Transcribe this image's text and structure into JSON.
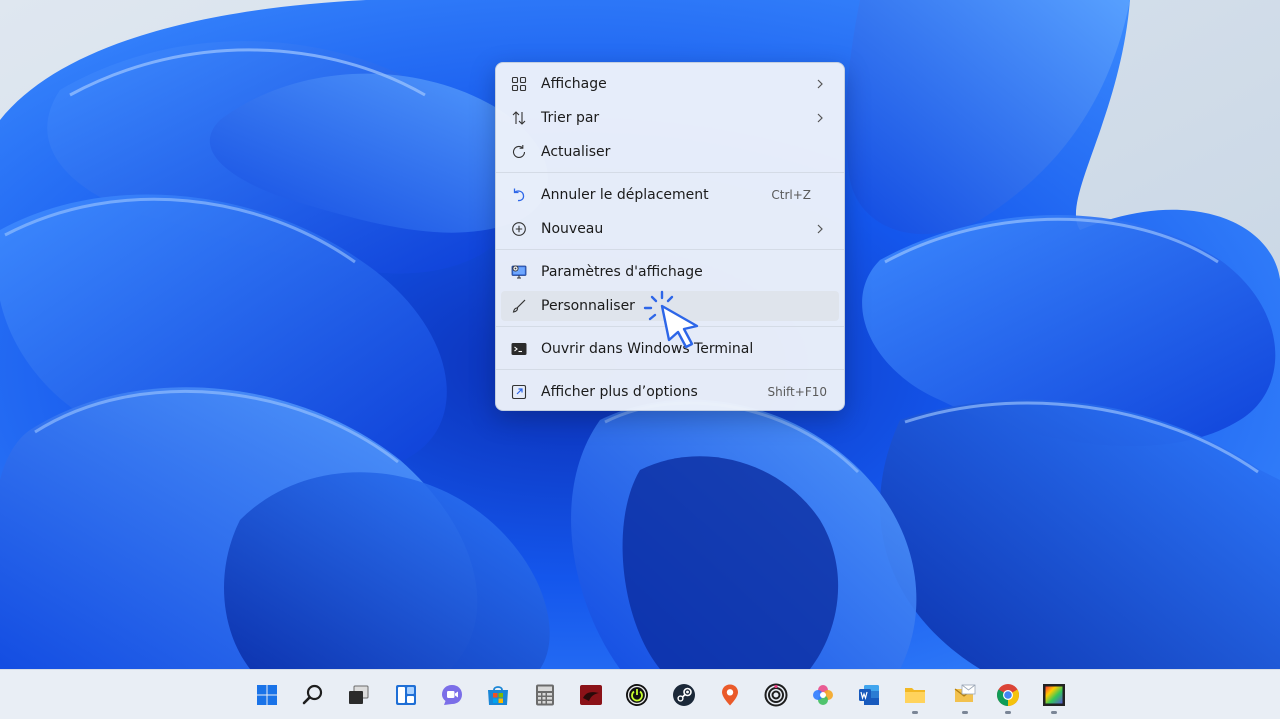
{
  "menu": {
    "items": [
      {
        "label": "Affichage",
        "icon": "view-grid-icon",
        "submenu": true
      },
      {
        "label": "Trier par",
        "icon": "sort-arrows-icon",
        "submenu": true
      },
      {
        "label": "Actualiser",
        "icon": "refresh-icon"
      },
      {
        "label": "Annuler le déplacement",
        "icon": "undo-icon",
        "shortcut": "Ctrl+Z"
      },
      {
        "label": "Nouveau",
        "icon": "new-plus-icon",
        "submenu": true
      },
      {
        "label": "Paramètres d'affichage",
        "icon": "display-settings-icon"
      },
      {
        "label": "Personnaliser",
        "icon": "brush-icon",
        "hovered": true
      },
      {
        "label": "Ouvrir dans Windows Terminal",
        "icon": "terminal-icon"
      },
      {
        "label": "Afficher plus d’options",
        "icon": "more-options-icon",
        "shortcut": "Shift+F10"
      }
    ]
  },
  "taskbar": {
    "icons": [
      {
        "name": "start-icon",
        "running": false
      },
      {
        "name": "search-icon",
        "running": false
      },
      {
        "name": "task-view-icon",
        "running": false
      },
      {
        "name": "widgets-icon",
        "running": false
      },
      {
        "name": "chat-icon",
        "running": false
      },
      {
        "name": "store-icon",
        "running": false
      },
      {
        "name": "calculator-icon",
        "running": false
      },
      {
        "name": "app-red-icon",
        "running": false
      },
      {
        "name": "app-power-icon",
        "running": false
      },
      {
        "name": "steam-icon",
        "running": false
      },
      {
        "name": "maps-pin-icon",
        "running": false
      },
      {
        "name": "app-rings-icon",
        "running": false
      },
      {
        "name": "photos-icon",
        "running": false
      },
      {
        "name": "word-icon",
        "running": false
      },
      {
        "name": "file-explorer-icon",
        "running": true
      },
      {
        "name": "mail-icon",
        "running": true
      },
      {
        "name": "chrome-icon",
        "running": true
      },
      {
        "name": "video-editor-icon",
        "running": true
      }
    ]
  },
  "colors": {
    "accent": "#2d66e8",
    "wallpaper_blue": "#1560f2",
    "menu_background": "#eef2fa",
    "taskbar_background": "#e9eef5"
  }
}
